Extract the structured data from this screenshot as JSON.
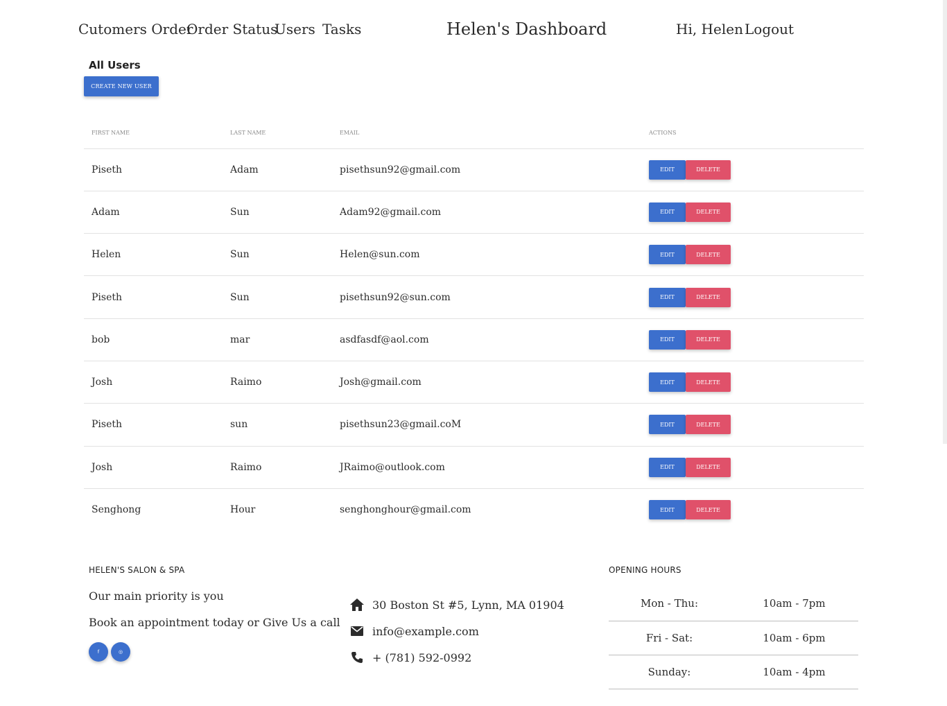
{
  "nav": {
    "links": [
      "Cutomers Order",
      "Order Status",
      "Users",
      "Tasks"
    ],
    "title": "Helen's Dashboard",
    "greeting": "Hi, Helen",
    "logout": "Logout"
  },
  "section": {
    "title": "All Users",
    "create_button": "CREATE NEW USER"
  },
  "table": {
    "headers": [
      "FIRST NAME",
      "LAST NAME",
      "EMAIL",
      "ACTIONS"
    ],
    "edit_label": "EDIT",
    "delete_label": "DELETE",
    "rows": [
      {
        "first": "Piseth",
        "last": "Adam",
        "email": "pisethsun92@gmail.com"
      },
      {
        "first": "Adam",
        "last": "Sun",
        "email": "Adam92@gmail.com"
      },
      {
        "first": "Helen",
        "last": "Sun",
        "email": "Helen@sun.com"
      },
      {
        "first": "Piseth",
        "last": "Sun",
        "email": "pisethsun92@sun.com"
      },
      {
        "first": "bob",
        "last": "mar",
        "email": "asdfasdf@aol.com"
      },
      {
        "first": "Josh",
        "last": "Raimo",
        "email": "Josh@gmail.com"
      },
      {
        "first": "Piseth",
        "last": "sun",
        "email": "pisethsun23@gmail.coM"
      },
      {
        "first": "Josh",
        "last": "Raimo",
        "email": "JRaimo@outlook.com"
      },
      {
        "first": "Senghong",
        "last": "Hour",
        "email": "senghonghour@gmail.com"
      }
    ]
  },
  "footer": {
    "about": {
      "heading": "HELEN'S SALON & SPA",
      "line1": "Our main priority is you",
      "line2": "Book an appointment today or Give Us a call",
      "social": [
        {
          "icon": "facebook-icon",
          "glyph": "f"
        },
        {
          "icon": "instagram-icon",
          "glyph": "◎"
        }
      ]
    },
    "contact": {
      "address": "30 Boston St #5, Lynn, MA 01904",
      "email": "info@example.com",
      "phone": "+ (781) 592-0992"
    },
    "hours": {
      "heading": "OPENING HOURS",
      "rows": [
        {
          "day": "Mon - Thu:",
          "time": "10am - 7pm"
        },
        {
          "day": "Fri - Sat:",
          "time": "10am - 6pm"
        },
        {
          "day": "Sunday:",
          "time": "10am - 4pm"
        }
      ]
    }
  },
  "colors": {
    "primary": "#3c6fcd",
    "danger": "#e0516a",
    "text": "#2b2b2b"
  }
}
